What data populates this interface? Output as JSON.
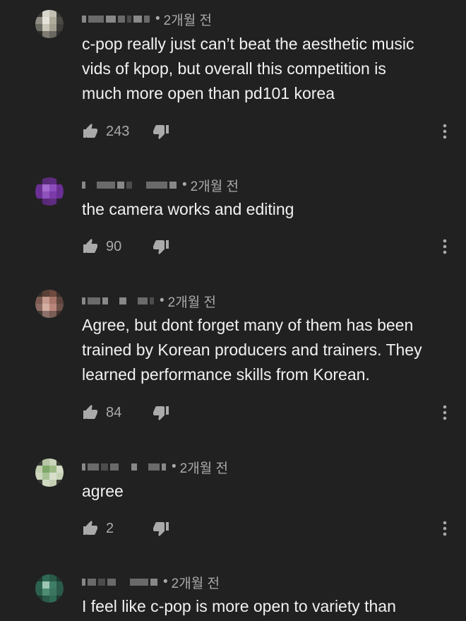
{
  "comments": [
    {
      "time": "2개월 전",
      "text": "c-pop really just can’t beat the aesthetic music\nvids of kpop, but overall this competition is\nmuch more open than pd101 korea",
      "likes": "243",
      "avatar_color": "#b9b5a4"
    },
    {
      "time": "2개월 전",
      "text": "the camera works and editing",
      "likes": "90",
      "avatar_color": "#7e2aa8"
    },
    {
      "time": "2개월 전",
      "text": "Agree, but dont forget many of them has been\ntrained by Korean producers and trainers. They\nlearned performance skills from Korean.",
      "likes": "84",
      "avatar_color": "#7a5a55"
    },
    {
      "time": "2개월 전",
      "text": "agree",
      "likes": "2",
      "avatar_color": "#c7d2b5"
    },
    {
      "time": "2개월 전",
      "text": "I feel like c-pop is more open to variety than",
      "likes": "",
      "avatar_color": "#2f6a56"
    }
  ],
  "icons": {
    "like": "thumb-up-icon",
    "dislike": "thumb-down-icon",
    "more": "more-vertical-icon"
  },
  "colors": {
    "background": "#212121",
    "text": "#f1f1f1",
    "secondary": "#aaaaaa"
  }
}
